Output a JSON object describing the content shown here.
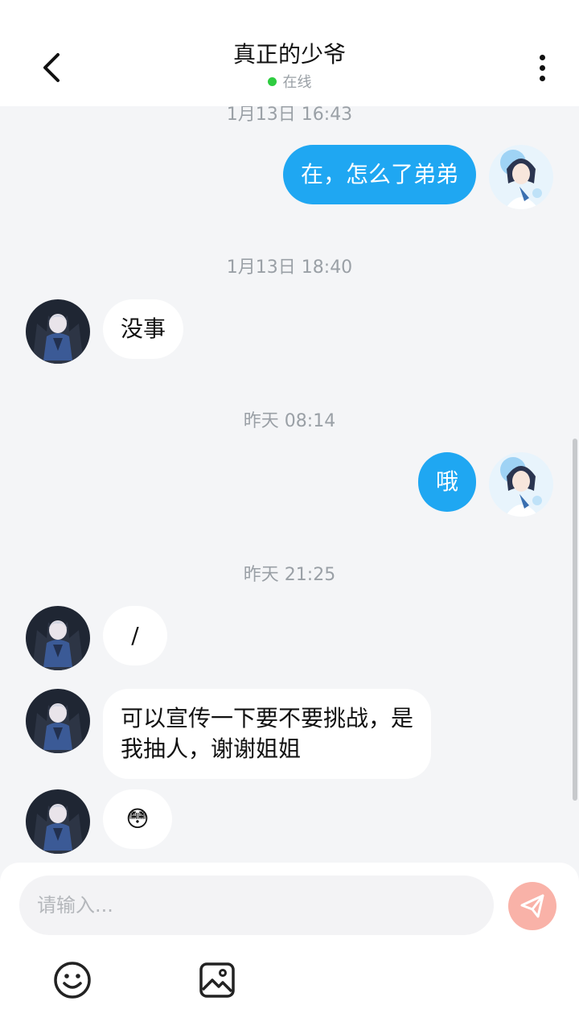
{
  "header": {
    "title": "真正的少爷",
    "status": "在线",
    "status_color": "#2ecc40"
  },
  "icons": {
    "back": "chevron-left-icon",
    "more": "more-vertical-icon",
    "send": "send-icon",
    "emoji": "emoji-icon",
    "image": "image-icon"
  },
  "colors": {
    "my_bubble": "#1fa7f2",
    "their_bubble": "#ffffff",
    "send_button": "#f9b2a8"
  },
  "chat": {
    "timestamps": [
      "1月13日 16:43",
      "1月13日 18:40",
      "昨天 08:14",
      "昨天 21:25"
    ],
    "messages": [
      {
        "sender": "me",
        "text": "在，怎么了弟弟"
      },
      {
        "sender": "them",
        "text": "没事"
      },
      {
        "sender": "me",
        "text": "哦"
      },
      {
        "sender": "them",
        "text": "/"
      },
      {
        "sender": "them",
        "line1": "可以宣传一下要不要挑战，是",
        "line2": "我抽人，谢谢姐姐"
      },
      {
        "sender": "them",
        "emoji": "😳"
      }
    ]
  },
  "composer": {
    "placeholder": "请输入..."
  }
}
